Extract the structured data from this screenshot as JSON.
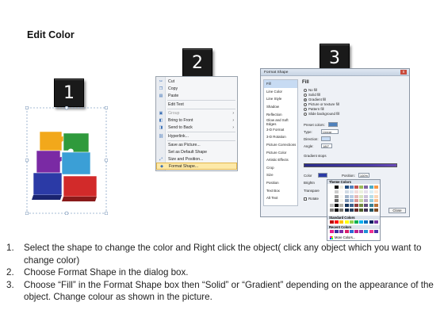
{
  "title": "Edit Color",
  "steps": [
    "1",
    "2",
    "3"
  ],
  "context_menu": {
    "items": [
      {
        "label": "Cut",
        "icon": "scissors-icon",
        "arrow": ""
      },
      {
        "label": "Copy",
        "icon": "copy-icon",
        "arrow": ""
      },
      {
        "label": "Paste",
        "icon": "paste-icon",
        "arrow": ""
      },
      {
        "label": "Edit Text",
        "icon": "",
        "arrow": ""
      },
      {
        "label": "Group",
        "icon": "group-icon",
        "arrow": "›"
      },
      {
        "label": "Bring to Front",
        "icon": "bring-front-icon",
        "arrow": "›"
      },
      {
        "label": "Send to Back",
        "icon": "send-back-icon",
        "arrow": "›"
      },
      {
        "label": "Hyperlink...",
        "icon": "hyperlink-icon",
        "arrow": ""
      },
      {
        "label": "Save as Picture...",
        "icon": "",
        "arrow": ""
      },
      {
        "label": "Set as Default Shape",
        "icon": "",
        "arrow": ""
      },
      {
        "label": "Size and Position...",
        "icon": "size-icon",
        "arrow": ""
      },
      {
        "label": "Format Shape...",
        "icon": "format-shape-icon",
        "arrow": ""
      }
    ]
  },
  "dialog": {
    "title": "Format Shape",
    "close_x": "x",
    "nav": [
      "Fill",
      "Line Color",
      "Line Style",
      "Shadow",
      "Reflection",
      "Glow and Soft Edges",
      "3-D Format",
      "3-D Rotation",
      "Picture Corrections",
      "Picture Color",
      "Artistic Effects",
      "Crop",
      "Size",
      "Position",
      "Text Box",
      "Alt Text"
    ],
    "heading": "Fill",
    "options": [
      "No fill",
      "Solid fill",
      "Gradient fill",
      "Picture or texture fill",
      "Pattern fill",
      "Slide background fill"
    ],
    "selected_option": 2,
    "preset_label": "Preset colors:",
    "type_label": "Type:",
    "type_value": "Linear",
    "direction_label": "Direction:",
    "angle_label": "Angle:",
    "angle_value": "180°",
    "stops_label": "Gradient stops",
    "color_label": "Color",
    "position_label": "Position:",
    "position_value": "100%",
    "brightness_label": "Brightn",
    "transparency_label": "Transpare",
    "rotate_label": "Rotate",
    "close_button": "Close"
  },
  "picker": {
    "theme_label": "Theme Colors",
    "standard_label": "Standard Colors",
    "recent_label": "Recent Colors",
    "more_label": "More Colors...",
    "theme_top": [
      "#ffffff",
      "#000000",
      "#eeece1",
      "#1f497d",
      "#4f81bd",
      "#c0504d",
      "#9bbb59",
      "#8064a2",
      "#4bacc6",
      "#f79646"
    ],
    "standard": [
      "#c00000",
      "#ff0000",
      "#ffc000",
      "#ffff00",
      "#92d050",
      "#00b050",
      "#00b0f0",
      "#0070c0",
      "#002060",
      "#7030a0"
    ],
    "recent": [
      "#e51f8a",
      "#3a2fa0",
      "#7b2fa8",
      "#d81f6b",
      "#2b6bd6",
      "#c01f8a",
      "#8e2fb0",
      "#1f8fd6",
      "#f0308f",
      "#4a2fa8"
    ]
  },
  "instructions": [
    {
      "num": "1.",
      "text": "Select the shape to change the color and Right click the object( click any object which you want to change color)"
    },
    {
      "num": "2.",
      "text": "Choose Format Shape in the dialog box."
    },
    {
      "num": "3.",
      "text": "Choose “Fill” in the Format Shape box then “Solid” or “Gradient” depending on the appearance of the object. Change colour as shown in the picture."
    }
  ]
}
